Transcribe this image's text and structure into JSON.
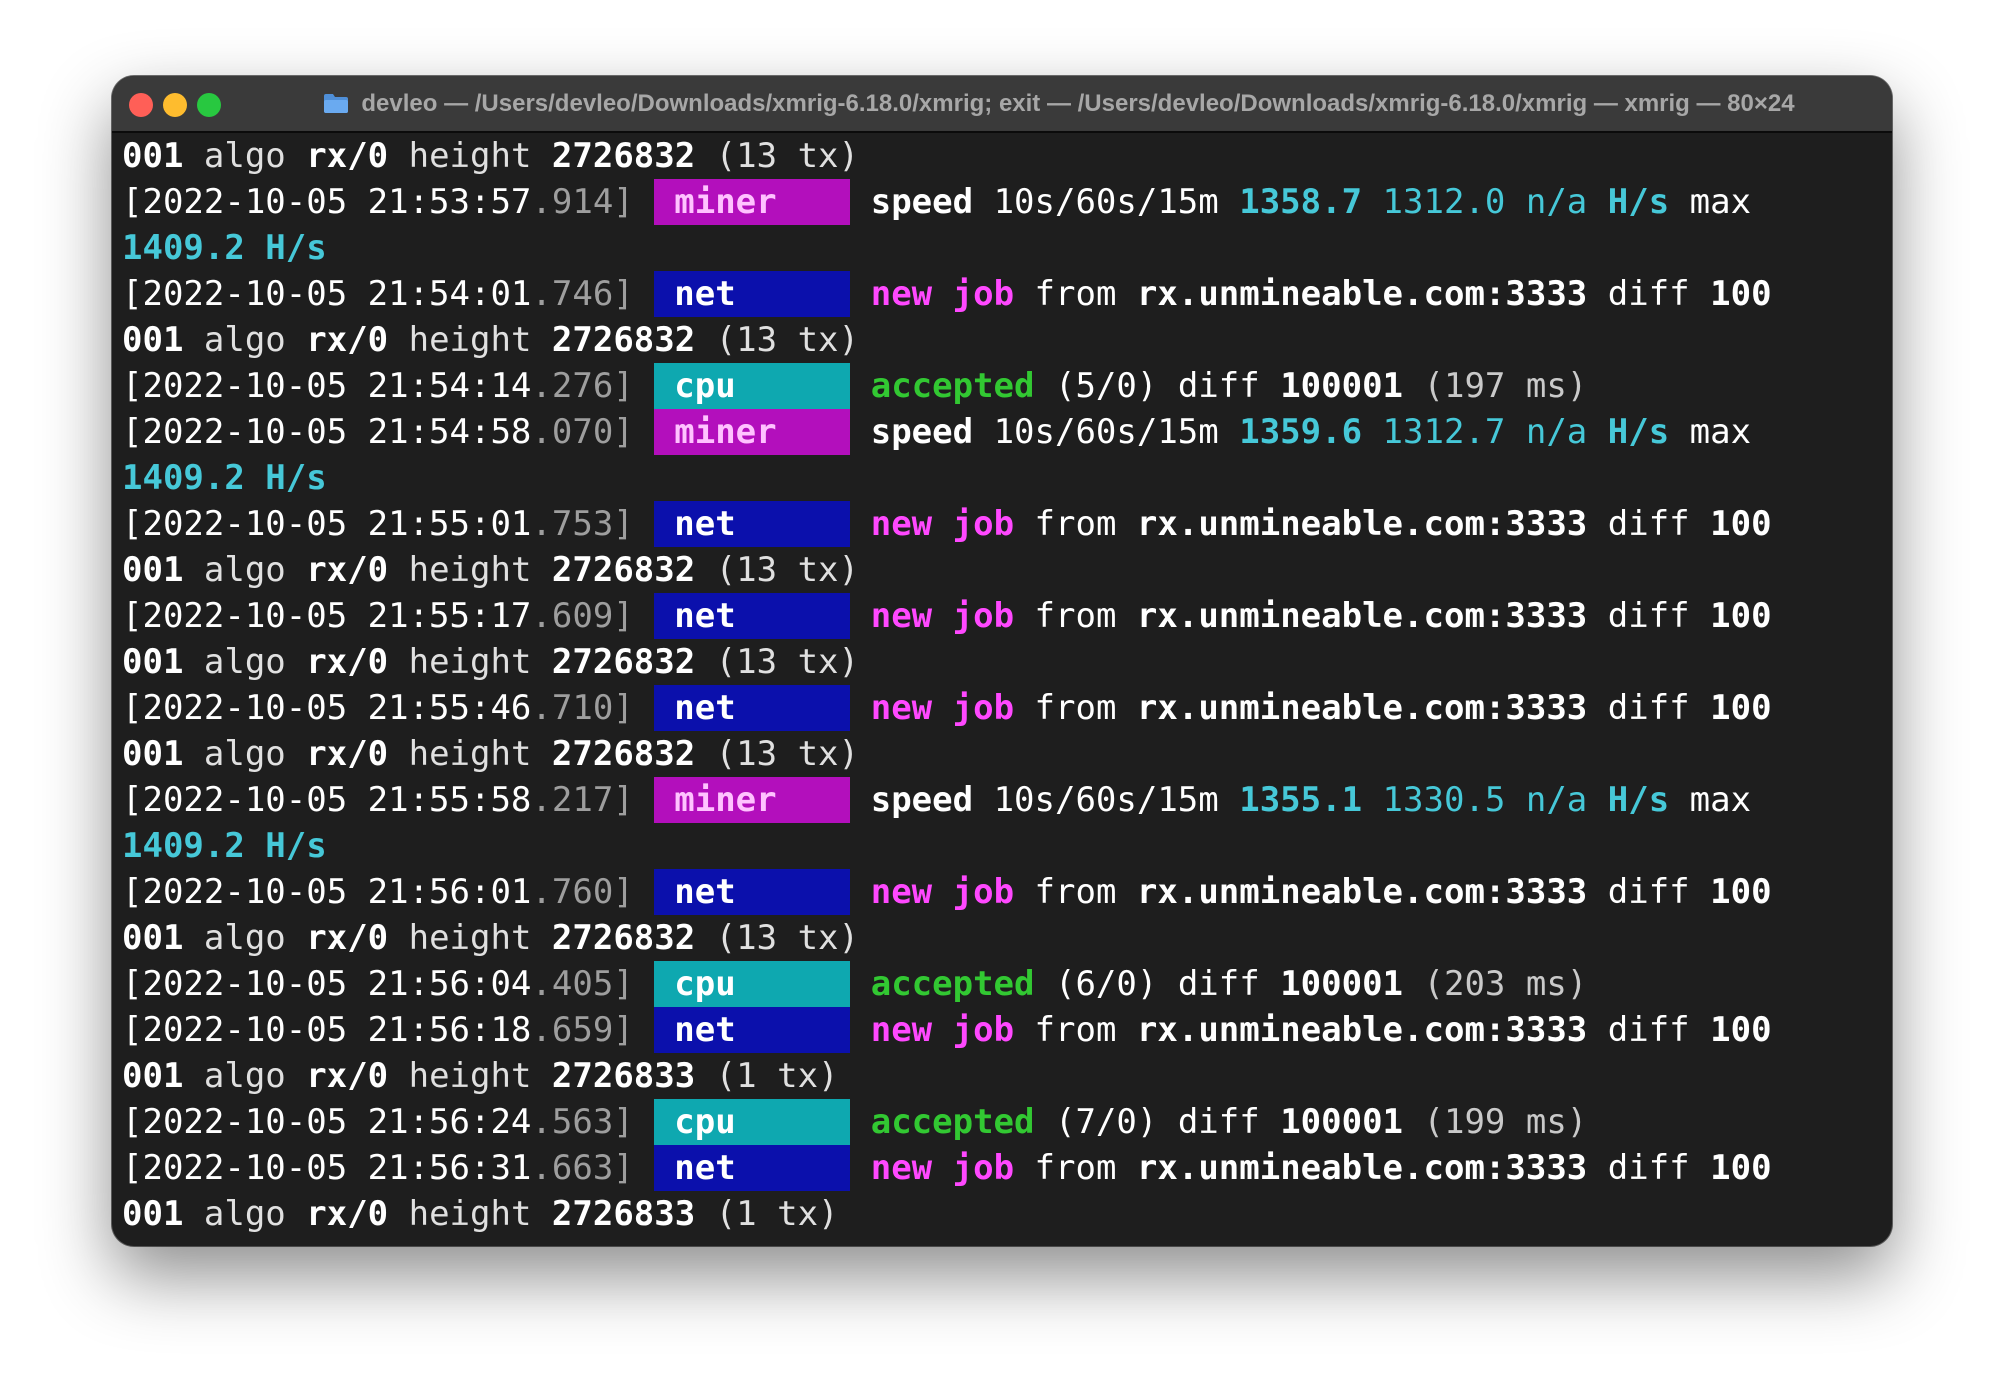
{
  "window": {
    "title": "devleo — /Users/devleo/Downloads/xmrig-6.18.0/xmrig; exit — /Users/devleo/Downloads/xmrig-6.18.0/xmrig — xmrig — 80×24",
    "icon": "folder-icon",
    "traffic_lights": [
      "close",
      "minimize",
      "zoom"
    ]
  },
  "colors": {
    "miner_tag_bg": "#b30fbc",
    "net_tag_bg": "#0b10ac",
    "cpu_tag_bg": "#0ea8b0",
    "new_job_text": "#ff48ff",
    "accepted_text": "#32c832",
    "hashrate_text": "#46c8d8",
    "terminal_bg": "#1e1e1e"
  },
  "lines": [
    {
      "rest": "001 algo rx/0 height 2726832 (13 tx)"
    },
    {
      "ts": "[2022-10-05 21:53:57",
      "ms": ".914]",
      "tag": "miner",
      "label": "speed",
      "windows": "10s/60s/15m",
      "v1": "1358.7",
      "v2": "1312.0",
      "v3": "n/a",
      "unit": "H/s",
      "max": "max"
    },
    {
      "cont": "1409.2 H/s"
    },
    {
      "ts": "[2022-10-05 21:54:01",
      "ms": ".746]",
      "tag": "net",
      "new": "new",
      "job": "job",
      "from": "from",
      "pool": "rx.unmineable.com:3333",
      "diff": "diff",
      "diffval": "100"
    },
    {
      "rest": "001 algo rx/0 height 2726832 (13 tx)"
    },
    {
      "ts": "[2022-10-05 21:54:14",
      "ms": ".276]",
      "tag": "cpu",
      "accepted": "accepted",
      "count": "(5/0)",
      "diff": "diff",
      "diffval": "100001",
      "lat": "(197 ms)"
    },
    {
      "ts": "[2022-10-05 21:54:58",
      "ms": ".070]",
      "tag": "miner",
      "label": "speed",
      "windows": "10s/60s/15m",
      "v1": "1359.6",
      "v2": "1312.7",
      "v3": "n/a",
      "unit": "H/s",
      "max": "max"
    },
    {
      "cont": "1409.2 H/s"
    },
    {
      "ts": "[2022-10-05 21:55:01",
      "ms": ".753]",
      "tag": "net",
      "new": "new",
      "job": "job",
      "from": "from",
      "pool": "rx.unmineable.com:3333",
      "diff": "diff",
      "diffval": "100"
    },
    {
      "rest": "001 algo rx/0 height 2726832 (13 tx)"
    },
    {
      "ts": "[2022-10-05 21:55:17",
      "ms": ".609]",
      "tag": "net",
      "new": "new",
      "job": "job",
      "from": "from",
      "pool": "rx.unmineable.com:3333",
      "diff": "diff",
      "diffval": "100"
    },
    {
      "rest": "001 algo rx/0 height 2726832 (13 tx)"
    },
    {
      "ts": "[2022-10-05 21:55:46",
      "ms": ".710]",
      "tag": "net",
      "new": "new",
      "job": "job",
      "from": "from",
      "pool": "rx.unmineable.com:3333",
      "diff": "diff",
      "diffval": "100"
    },
    {
      "rest": "001 algo rx/0 height 2726832 (13 tx)"
    },
    {
      "ts": "[2022-10-05 21:55:58",
      "ms": ".217]",
      "tag": "miner",
      "label": "speed",
      "windows": "10s/60s/15m",
      "v1": "1355.1",
      "v2": "1330.5",
      "v3": "n/a",
      "unit": "H/s",
      "max": "max"
    },
    {
      "cont": "1409.2 H/s"
    },
    {
      "ts": "[2022-10-05 21:56:01",
      "ms": ".760]",
      "tag": "net",
      "new": "new",
      "job": "job",
      "from": "from",
      "pool": "rx.unmineable.com:3333",
      "diff": "diff",
      "diffval": "100"
    },
    {
      "rest": "001 algo rx/0 height 2726832 (13 tx)"
    },
    {
      "ts": "[2022-10-05 21:56:04",
      "ms": ".405]",
      "tag": "cpu",
      "accepted": "accepted",
      "count": "(6/0)",
      "diff": "diff",
      "diffval": "100001",
      "lat": "(203 ms)"
    },
    {
      "ts": "[2022-10-05 21:56:18",
      "ms": ".659]",
      "tag": "net",
      "new": "new",
      "job": "job",
      "from": "from",
      "pool": "rx.unmineable.com:3333",
      "diff": "diff",
      "diffval": "100"
    },
    {
      "rest": "001 algo rx/0 height 2726833 (1 tx)"
    },
    {
      "ts": "[2022-10-05 21:56:24",
      "ms": ".563]",
      "tag": "cpu",
      "accepted": "accepted",
      "count": "(7/0)",
      "diff": "diff",
      "diffval": "100001",
      "lat": "(199 ms)"
    },
    {
      "ts": "[2022-10-05 21:56:31",
      "ms": ".663]",
      "tag": "net",
      "new": "new",
      "job": "job",
      "from": "from",
      "pool": "rx.unmineable.com:3333",
      "diff": "diff",
      "diffval": "100"
    },
    {
      "rest": "001 algo rx/0 height 2726833 (1 tx)"
    }
  ]
}
